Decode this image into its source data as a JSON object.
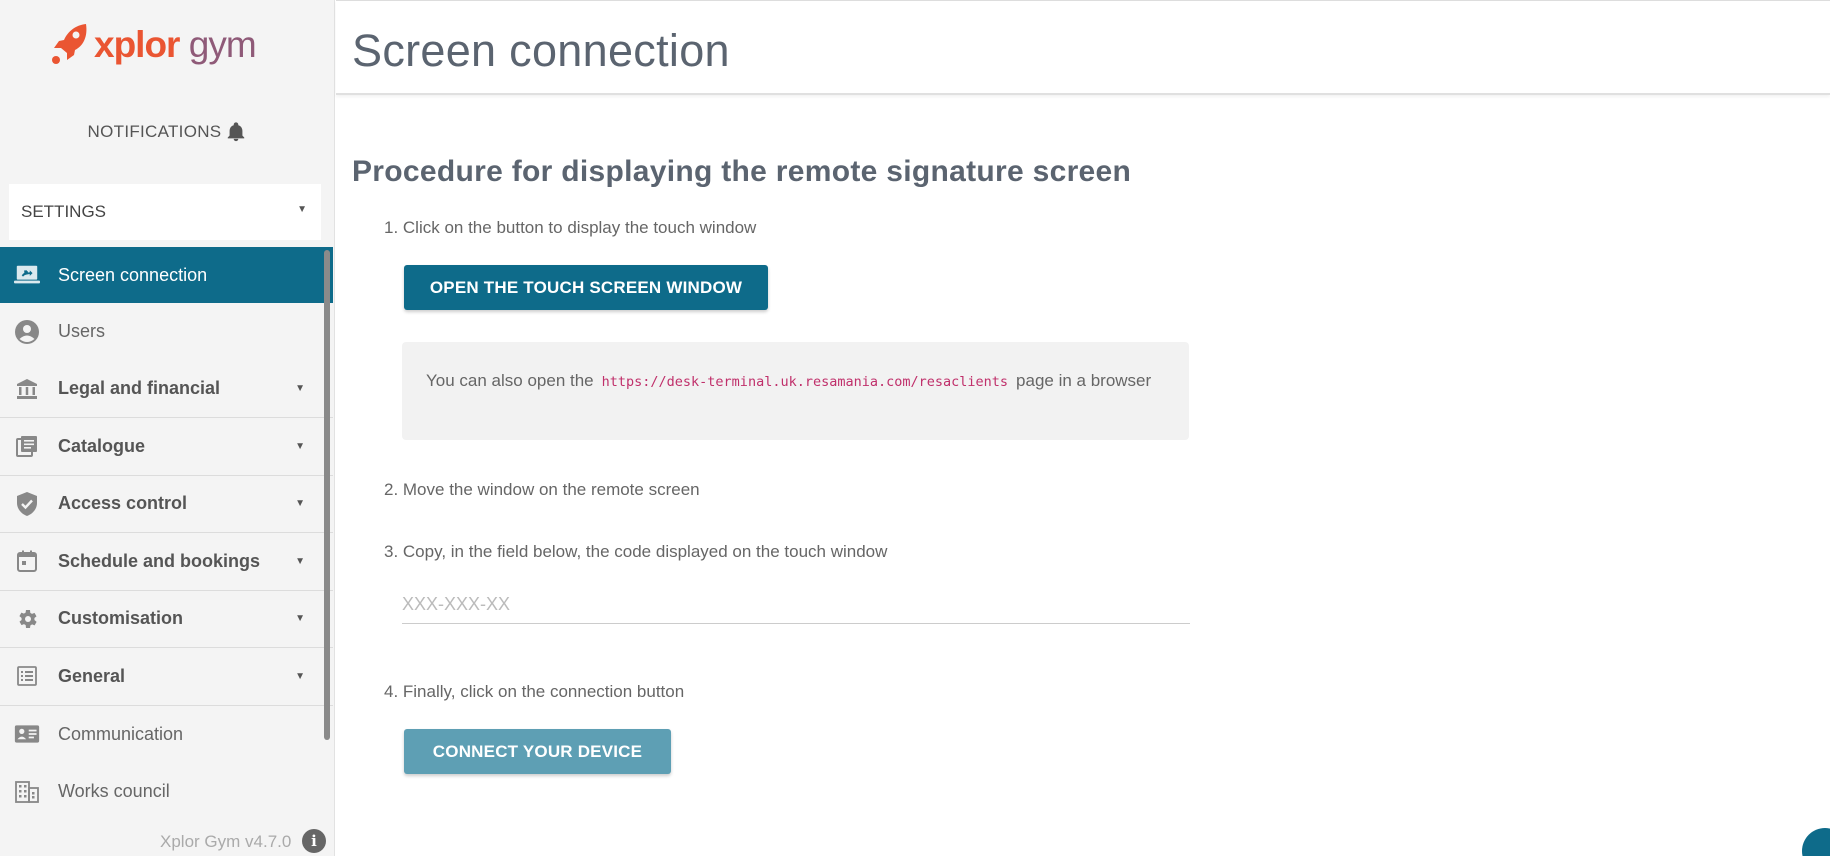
{
  "brand": {
    "part1": "xplor",
    "part2": "gym"
  },
  "sidebar": {
    "notifications_label": "NOTIFICATIONS",
    "settings_label": "SETTINGS",
    "items": [
      {
        "label": "Screen connection",
        "icon": "laptop-icon"
      },
      {
        "label": "Users",
        "icon": "user-circle-icon"
      },
      {
        "label": "Legal and financial",
        "icon": "bank-icon"
      },
      {
        "label": "Catalogue",
        "icon": "catalogue-icon"
      },
      {
        "label": "Access control",
        "icon": "shield-check-icon"
      },
      {
        "label": "Schedule and bookings",
        "icon": "calendar-icon"
      },
      {
        "label": "Customisation",
        "icon": "gear-icon"
      },
      {
        "label": "General",
        "icon": "list-icon"
      },
      {
        "label": "Communication",
        "icon": "contact-card-icon"
      },
      {
        "label": "Works council",
        "icon": "building-icon"
      }
    ],
    "version": "Xplor Gym v4.7.0"
  },
  "main": {
    "page_title": "Screen connection",
    "section_title": "Procedure for displaying the remote signature screen",
    "step1": "1. Click on the button to display the touch window",
    "open_button": "OPEN THE TOUCH SCREEN WINDOW",
    "info_prefix": "You can also open the",
    "info_url": "https://desk-terminal.uk.resamania.com/resaclients",
    "info_suffix": "page in a browser",
    "step2": "2. Move the window on the remote screen",
    "step3": "3. Copy, in the field below, the code displayed on the touch window",
    "code_placeholder": "XXX-XXX-XX",
    "step4": "4. Finally, click on the connection button",
    "connect_button": "CONNECT YOUR DEVICE"
  },
  "colors": {
    "primary": "#0e6b8a",
    "primary_disabled": "#5e9fb4",
    "brand_orange": "#ea5532",
    "brand_purple": "#8f5a78",
    "code_text": "#c0306b"
  }
}
